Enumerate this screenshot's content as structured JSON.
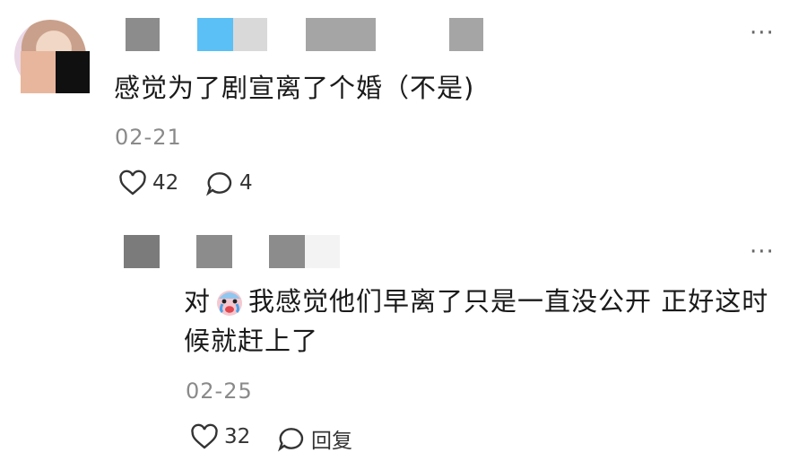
{
  "comment1": {
    "text": "感觉为了剧宣离了个婚（不是)",
    "date": "02-21",
    "likes": "42",
    "replies": "4",
    "more_icon": "more-icon"
  },
  "comment2": {
    "text_prefix": "对",
    "text_main": "我感觉他们早离了只是一直没公开 正好这时",
    "text_line2": "候就赶上了",
    "date": "02-25",
    "likes": "32",
    "reply_label": "回复",
    "emoji_icon": "crying-face-emoji",
    "more_icon": "more-icon"
  }
}
